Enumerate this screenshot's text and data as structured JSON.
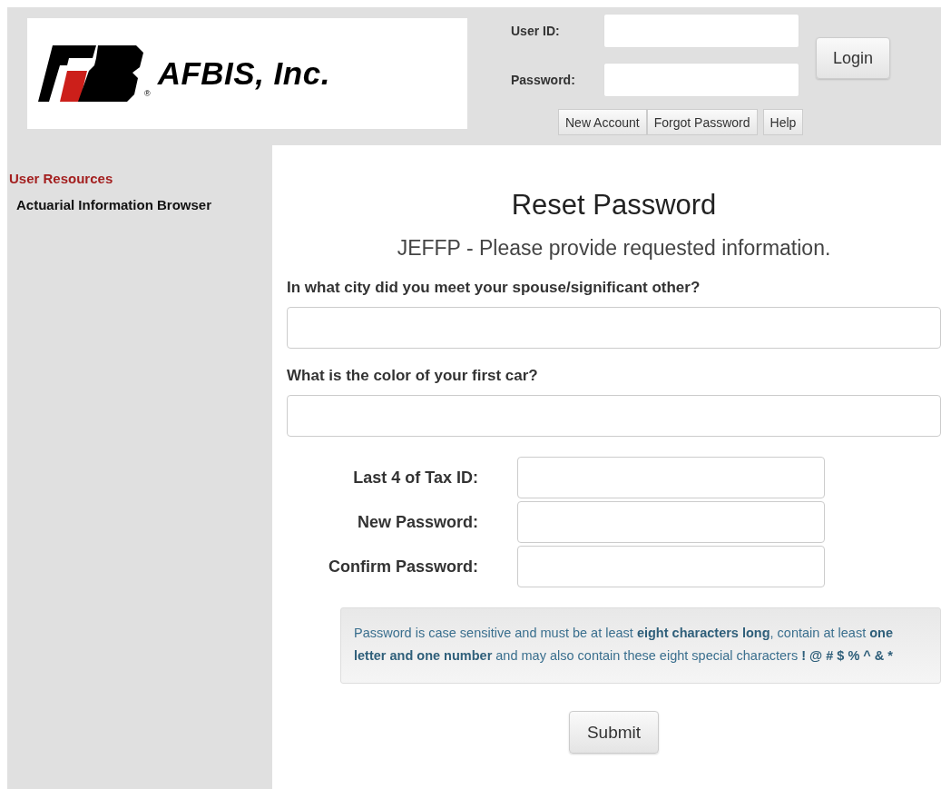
{
  "header": {
    "logo": {
      "name": "AFBIS, Inc.",
      "mark": "®"
    },
    "login": {
      "fields": [
        {
          "label": "User ID:"
        },
        {
          "label": "Password:"
        }
      ],
      "login_button": "Login",
      "links": [
        "New Account",
        "Forgot Password",
        "Help"
      ]
    }
  },
  "sidebar": {
    "heading": "User Resources",
    "items": [
      {
        "label": "Actuarial Information Browser"
      }
    ]
  },
  "main": {
    "title": "Reset Password",
    "subtitle": "JEFFP - Please provide requested information.",
    "questions": [
      {
        "label": "In what city did you meet your spouse/significant other?"
      },
      {
        "label": "What is the color of your first car?"
      }
    ],
    "fields": [
      {
        "label": "Last 4 of Tax ID:"
      },
      {
        "label": "New Password:"
      },
      {
        "label": "Confirm Password:"
      }
    ],
    "note": [
      {
        "text": "Password is case sensitive and must be at least ",
        "bold": false
      },
      {
        "text": "eight characters long",
        "bold": true
      },
      {
        "text": ", contain at least ",
        "bold": false
      },
      {
        "text": "one letter and one number",
        "bold": true
      },
      {
        "text": " and may also contain these eight special characters ",
        "bold": false
      },
      {
        "text": "! @ # $ % ^ & *",
        "bold": true
      }
    ],
    "submit": "Submit"
  }
}
